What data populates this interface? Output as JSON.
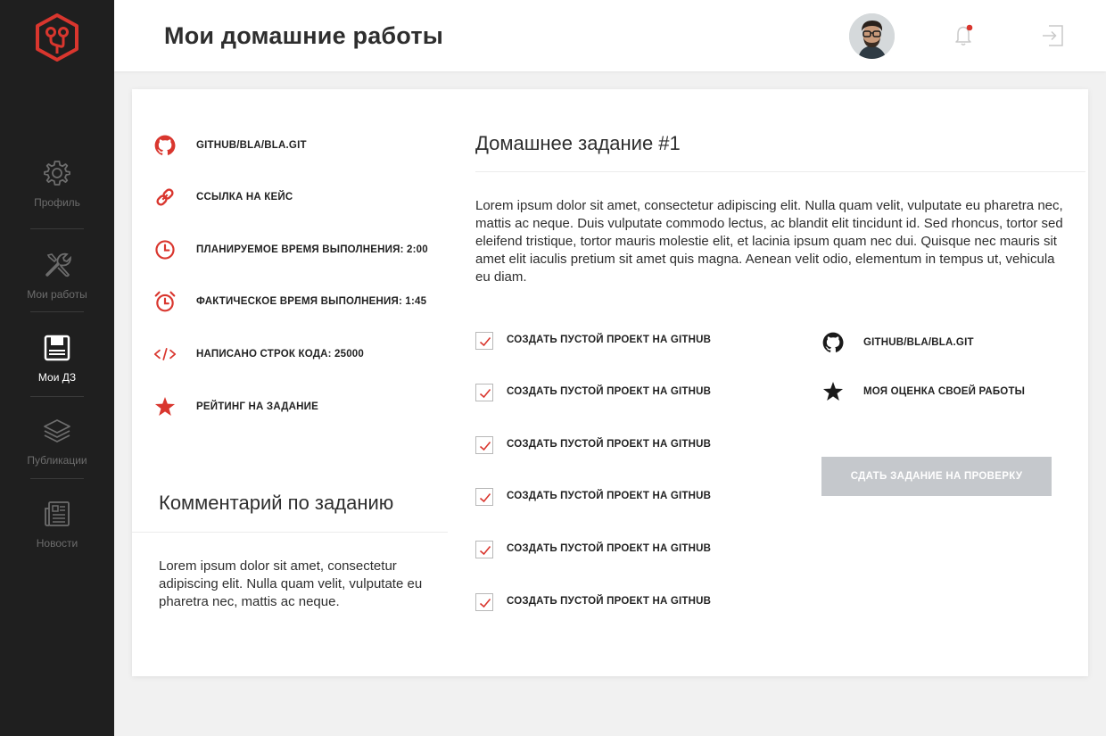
{
  "colors": {
    "accent": "#d9362e",
    "sidebar_bg": "#1f1f1f",
    "button_disabled": "#c5c8cc"
  },
  "sidebar": {
    "logo_icon": "hexagon-branch-logo",
    "items": [
      {
        "label": "Профиль",
        "icon": "gear-icon",
        "active": false
      },
      {
        "label": "Мои работы",
        "icon": "tools-icon",
        "active": false
      },
      {
        "label": "Мои ДЗ",
        "icon": "floppy-disk-icon",
        "active": true
      },
      {
        "label": "Публикации",
        "icon": "layers-icon",
        "active": false
      },
      {
        "label": "Новости",
        "icon": "newspaper-icon",
        "active": false
      }
    ]
  },
  "header": {
    "title": "Мои домашние работы",
    "icons": [
      "avatar",
      "bell-icon",
      "logout-icon"
    ]
  },
  "info": [
    {
      "icon": "github-icon",
      "text": "GITHUB/BLA/BLA.GIT"
    },
    {
      "icon": "link-icon",
      "text": "ССЫЛКА НА КЕЙС"
    },
    {
      "icon": "clock-icon",
      "text": "ПЛАНИРУЕМОЕ ВРЕМЯ ВЫПОЛНЕНИЯ: 2:00"
    },
    {
      "icon": "alarm-clock-icon",
      "text": "ФАКТИЧЕСКОЕ ВРЕМЯ ВЫПОЛНЕНИЯ: 1:45"
    },
    {
      "icon": "code-icon",
      "text": "НАПИСАНО СТРОК КОДА: 25000"
    },
    {
      "icon": "star-icon",
      "text": "РЕЙТИНГ НА ЗАДАНИЕ"
    }
  ],
  "comment": {
    "title": "Комментарий по заданию",
    "text": "Lorem ipsum dolor sit amet, consectetur adipiscing elit. Nulla quam velit, vulputate eu pharetra nec, mattis ac neque."
  },
  "homework": {
    "title": "Домашнее задание #1",
    "description": "Lorem ipsum dolor sit amet, consectetur adipiscing elit. Nulla quam velit, vulputate eu pharetra nec, mattis ac neque. Duis vulputate commodo lectus, ac blandit elit tincidunt id. Sed rhoncus, tortor sed eleifend tristique, tortor mauris molestie elit, et lacinia ipsum quam nec dui. Quisque nec mauris sit amet elit iaculis pretium sit amet quis magna. Aenean velit odio, elementum in tempus ut, vehicula eu diam.",
    "tasks": [
      {
        "label": "СОЗДАТЬ ПУСТОЙ ПРОЕКТ НА GITHUB",
        "checked": true
      },
      {
        "label": "СОЗДАТЬ ПУСТОЙ ПРОЕКТ НА GITHUB",
        "checked": true
      },
      {
        "label": "СОЗДАТЬ ПУСТОЙ ПРОЕКТ НА GITHUB",
        "checked": true
      },
      {
        "label": "СОЗДАТЬ ПУСТОЙ ПРОЕКТ НА GITHUB",
        "checked": true
      },
      {
        "label": "СОЗДАТЬ ПУСТОЙ ПРОЕКТ НА GITHUB",
        "checked": true
      },
      {
        "label": "СОЗДАТЬ ПУСТОЙ ПРОЕКТ НА GITHUB",
        "checked": true
      }
    ],
    "side": [
      {
        "icon": "github-icon",
        "text": "GITHUB/BLA/BLA.GIT"
      },
      {
        "icon": "star-icon",
        "text": "МОЯ ОЦЕНКА СВОЕЙ РАБОТЫ"
      }
    ],
    "submit_label": "СДАТЬ ЗАДАНИЕ НА ПРОВЕРКУ"
  }
}
